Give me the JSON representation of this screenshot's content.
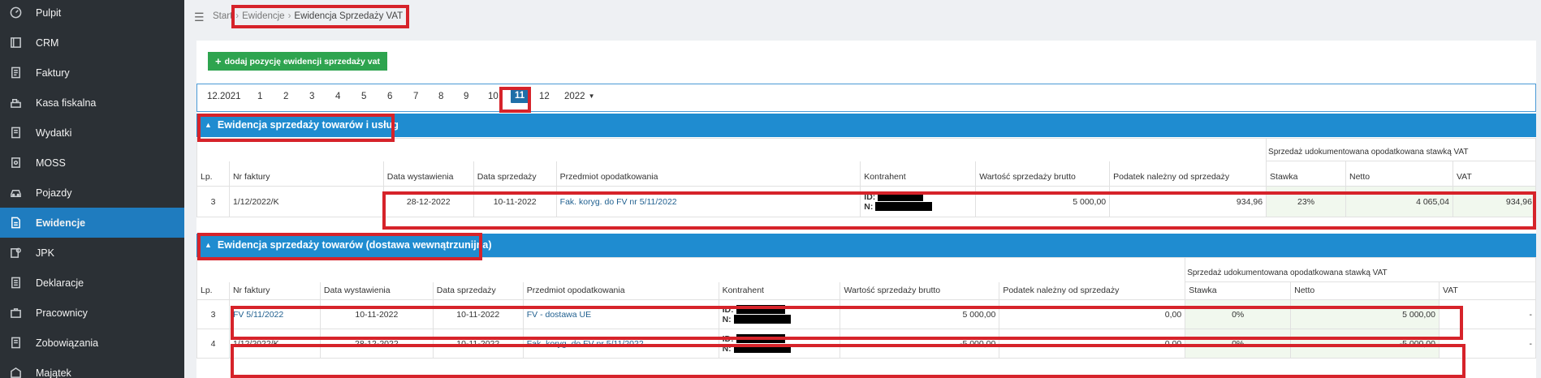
{
  "sidebar": {
    "items": [
      {
        "label": "Pulpit",
        "icon": "dashboard-icon"
      },
      {
        "label": "CRM",
        "icon": "crm-icon"
      },
      {
        "label": "Faktury",
        "icon": "invoice-icon"
      },
      {
        "label": "Kasa fiskalna",
        "icon": "cash-register-icon"
      },
      {
        "label": "Wydatki",
        "icon": "expenses-icon"
      },
      {
        "label": "MOSS",
        "icon": "moss-icon"
      },
      {
        "label": "Pojazdy",
        "icon": "car-icon"
      },
      {
        "label": "Ewidencje",
        "icon": "records-icon",
        "active": true
      },
      {
        "label": "JPK",
        "icon": "jpk-icon"
      },
      {
        "label": "Deklaracje",
        "icon": "declarations-icon"
      },
      {
        "label": "Pracownicy",
        "icon": "employees-icon"
      },
      {
        "label": "Zobowiązania",
        "icon": "liabilities-icon"
      },
      {
        "label": "Majątek",
        "icon": "assets-icon"
      }
    ]
  },
  "breadcrumb": {
    "start": "Start",
    "level1": "Ewidencje",
    "current": "Ewidencja Sprzedaży VAT"
  },
  "toolbar": {
    "add_label": "dodaj pozycję ewidencji sprzedaży vat"
  },
  "months": {
    "items": [
      "12.2021",
      "1",
      "2",
      "3",
      "4",
      "5",
      "6",
      "7",
      "8",
      "9",
      "10",
      "11",
      "12"
    ],
    "active": "11",
    "year": "2022"
  },
  "section1": {
    "title": "Ewidencja sprzedaży towarów i usług",
    "group_header": "Sprzedaż udokumentowana opodatkowana stawką VAT",
    "columns": [
      "Lp.",
      "Nr faktury",
      "Data wystawienia",
      "Data sprzedaży",
      "Przedmiot opodatkowania",
      "Kontrahent",
      "Wartość sprzedaży brutto",
      "Podatek należny od sprzedaży",
      "Stawka",
      "Netto",
      "VAT"
    ],
    "rows": [
      {
        "lp": "3",
        "nr": "1/12/2022/K",
        "data_wyst": "28-12-2022",
        "data_sprz": "10-11-2022",
        "przedmiot": "Fak. koryg. do FV nr 5/11/2022",
        "id_label": "ID:",
        "n_label": "N:",
        "brutto": "5 000,00",
        "podatek": "934,96",
        "stawka": "23%",
        "netto": "4 065,04",
        "vat": "934,96"
      }
    ]
  },
  "section2": {
    "title": "Ewidencja sprzedaży towarów (dostawa wewnątrzunijna)",
    "group_header": "Sprzedaż udokumentowana opodatkowana stawką VAT",
    "columns": [
      "Lp.",
      "Nr faktury",
      "Data wystawienia",
      "Data sprzedaży",
      "Przedmiot opodatkowania",
      "Kontrahent",
      "Wartość sprzedaży brutto",
      "Podatek należny od sprzedaży",
      "Stawka",
      "Netto",
      "VAT"
    ],
    "rows": [
      {
        "lp": "3",
        "nr": "FV 5/11/2022",
        "data_wyst": "10-11-2022",
        "data_sprz": "10-11-2022",
        "przedmiot": "FV - dostawa UE",
        "id_label": "ID:",
        "n_label": "N:",
        "brutto": "5 000,00",
        "podatek": "0,00",
        "stawka": "0%",
        "netto": "5 000,00",
        "vat": "-"
      },
      {
        "lp": "4",
        "nr": "1/12/2022/K",
        "data_wyst": "28-12-2022",
        "data_sprz": "10-11-2022",
        "przedmiot": "Fak. koryg. do FV nr 5/11/2022",
        "id_label": "ID:",
        "n_label": "N:",
        "brutto": "-5 000,00",
        "podatek": "0,00",
        "stawka": "0%",
        "netto": "-5 000,00",
        "vat": "-"
      }
    ]
  },
  "colors": {
    "sidebar": "#2b3035",
    "active": "#1f7cbf",
    "section": "#1f8cd0",
    "add_button": "#2ea44f",
    "highlight": "#d6232a"
  }
}
